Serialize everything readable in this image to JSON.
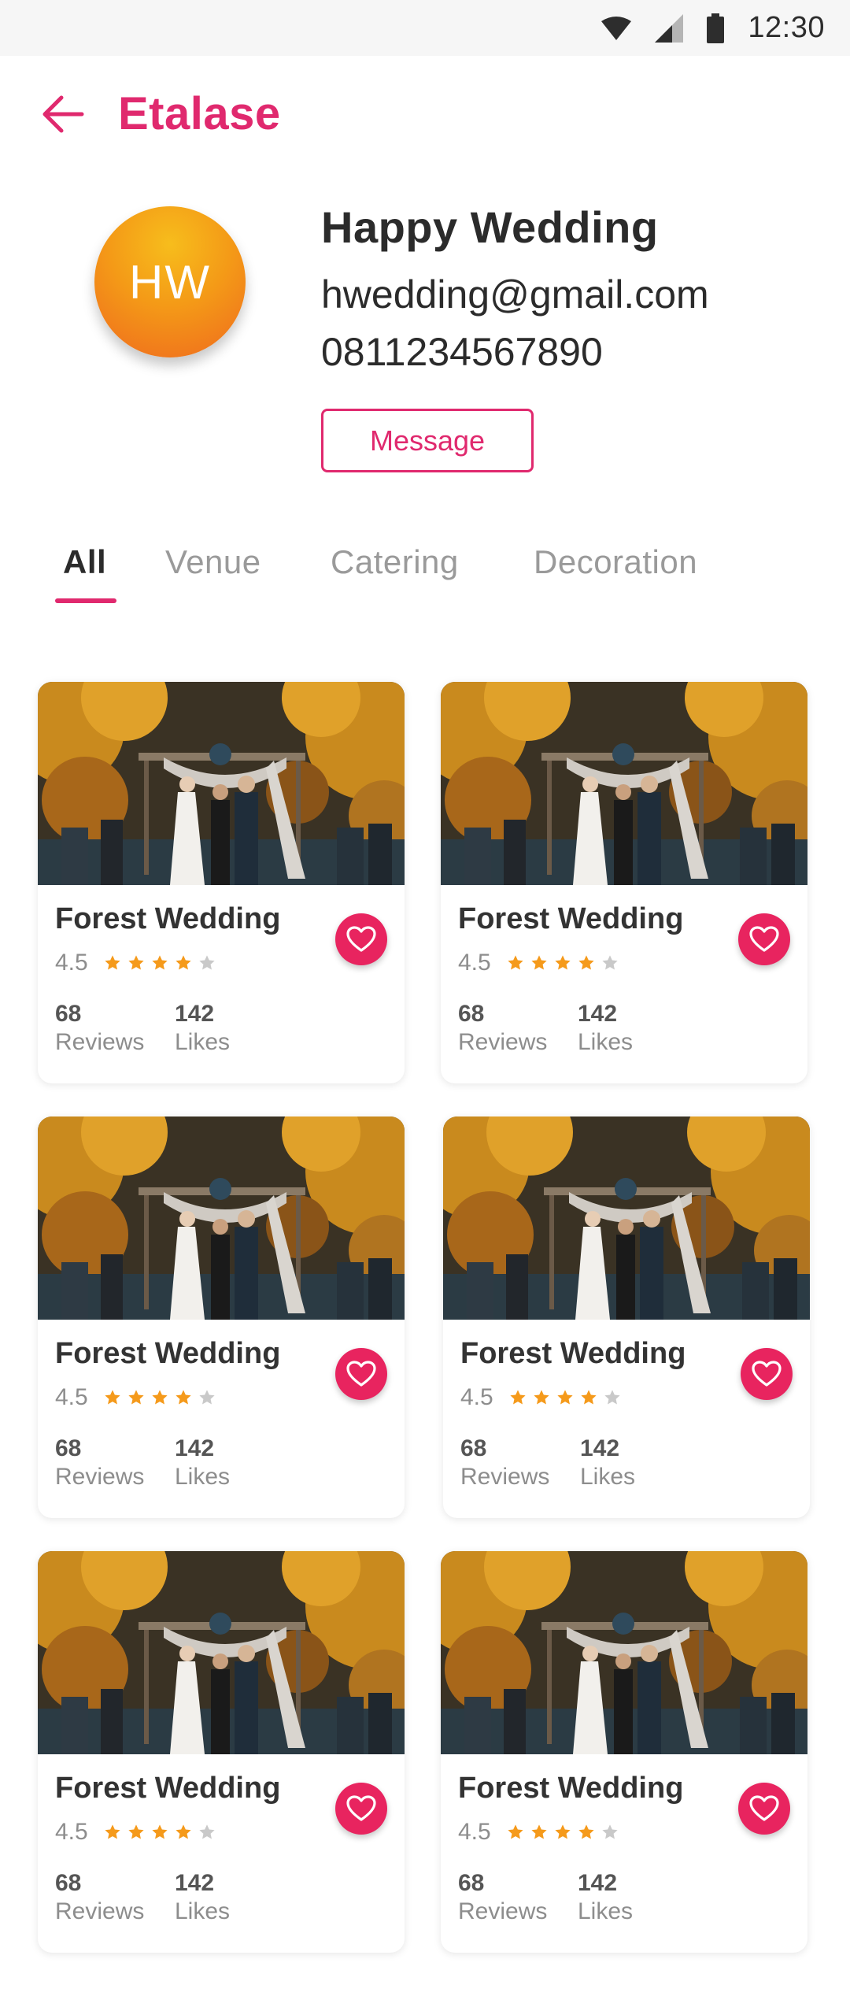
{
  "status_bar": {
    "time": "12:30",
    "icons": [
      "wifi-icon",
      "signal-icon",
      "battery-icon"
    ]
  },
  "app_bar": {
    "title": "Etalase",
    "back_icon": "arrow-left-icon"
  },
  "profile": {
    "initials": "HW",
    "name": "Happy Wedding",
    "email": "hwedding@gmail.com",
    "phone": "0811234567890",
    "message_label": "Message"
  },
  "tabs": [
    {
      "label": "All",
      "active": true
    },
    {
      "label": "Venue",
      "active": false
    },
    {
      "label": "Catering",
      "active": false
    },
    {
      "label": "Decoration",
      "active": false
    }
  ],
  "products": [
    {
      "title": "Forest Wedding",
      "rating": "4.5",
      "stars": 4,
      "reviews": "68",
      "reviews_label": "Reviews",
      "likes": "142",
      "likes_label": "Likes"
    },
    {
      "title": "Forest Wedding",
      "rating": "4.5",
      "stars": 4,
      "reviews": "68",
      "reviews_label": "Reviews",
      "likes": "142",
      "likes_label": "Likes"
    },
    {
      "title": "Forest Wedding",
      "rating": "4.5",
      "stars": 4,
      "reviews": "68",
      "reviews_label": "Reviews",
      "likes": "142",
      "likes_label": "Likes"
    },
    {
      "title": "Forest Wedding",
      "rating": "4.5",
      "stars": 4,
      "reviews": "68",
      "reviews_label": "Reviews",
      "likes": "142",
      "likes_label": "Likes"
    },
    {
      "title": "Forest Wedding",
      "rating": "4.5",
      "stars": 4,
      "reviews": "68",
      "reviews_label": "Reviews",
      "likes": "142",
      "likes_label": "Likes"
    },
    {
      "title": "Forest Wedding",
      "rating": "4.5",
      "stars": 4,
      "reviews": "68",
      "reviews_label": "Reviews",
      "likes": "142",
      "likes_label": "Likes"
    }
  ],
  "colors": {
    "accent": "#e0296e",
    "star": "#f59a1b",
    "star_empty": "#c9c9c9",
    "avatar_start": "#f7bd1c",
    "avatar_end": "#ef6a1e"
  }
}
